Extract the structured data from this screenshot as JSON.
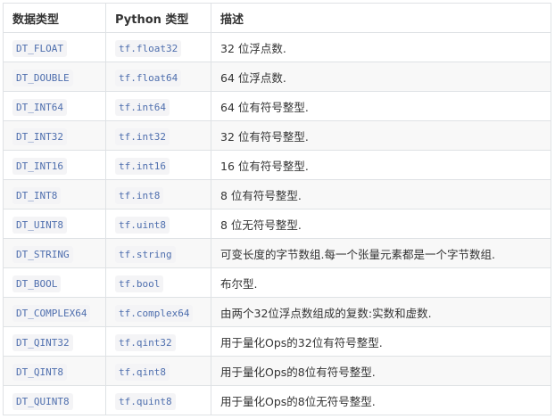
{
  "table": {
    "headers": [
      "数据类型",
      "Python 类型",
      "描述"
    ],
    "rows": [
      {
        "dtype": "DT_FLOAT",
        "python": "tf.float32",
        "desc": "32 位浮点数."
      },
      {
        "dtype": "DT_DOUBLE",
        "python": "tf.float64",
        "desc": "64 位浮点数."
      },
      {
        "dtype": "DT_INT64",
        "python": "tf.int64",
        "desc": "64 位有符号整型."
      },
      {
        "dtype": "DT_INT32",
        "python": "tf.int32",
        "desc": "32 位有符号整型."
      },
      {
        "dtype": "DT_INT16",
        "python": "tf.int16",
        "desc": "16 位有符号整型."
      },
      {
        "dtype": "DT_INT8",
        "python": "tf.int8",
        "desc": "8 位有符号整型."
      },
      {
        "dtype": "DT_UINT8",
        "python": "tf.uint8",
        "desc": "8 位无符号整型."
      },
      {
        "dtype": "DT_STRING",
        "python": "tf.string",
        "desc": "可变长度的字节数组.每一个张量元素都是一个字节数组."
      },
      {
        "dtype": "DT_BOOL",
        "python": "tf.bool",
        "desc": "布尔型."
      },
      {
        "dtype": "DT_COMPLEX64",
        "python": "tf.complex64",
        "desc": "由两个32位浮点数组成的复数:实数和虚数."
      },
      {
        "dtype": "DT_QINT32",
        "python": "tf.qint32",
        "desc": "用于量化Ops的32位有符号整型."
      },
      {
        "dtype": "DT_QINT8",
        "python": "tf.qint8",
        "desc": "用于量化Ops的8位有符号整型."
      },
      {
        "dtype": "DT_QUINT8",
        "python": "tf.quint8",
        "desc": "用于量化Ops的8位无符号整型."
      }
    ]
  },
  "colors": {
    "border": "#dfe2e5",
    "stripe": "#f8f8f8",
    "code_text": "#4f6fae",
    "code_bg": "#f4f4f6",
    "text": "#333333"
  }
}
